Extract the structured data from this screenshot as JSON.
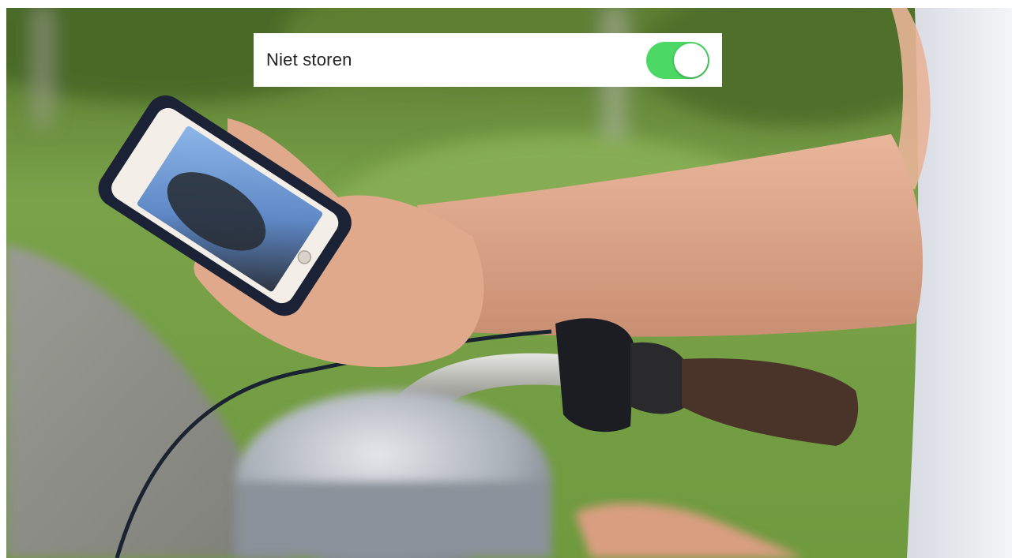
{
  "setting": {
    "label": "Niet storen",
    "toggle_state": "on",
    "toggle_color": "#4cd864"
  },
  "photo": {
    "subject": "photo"
  }
}
